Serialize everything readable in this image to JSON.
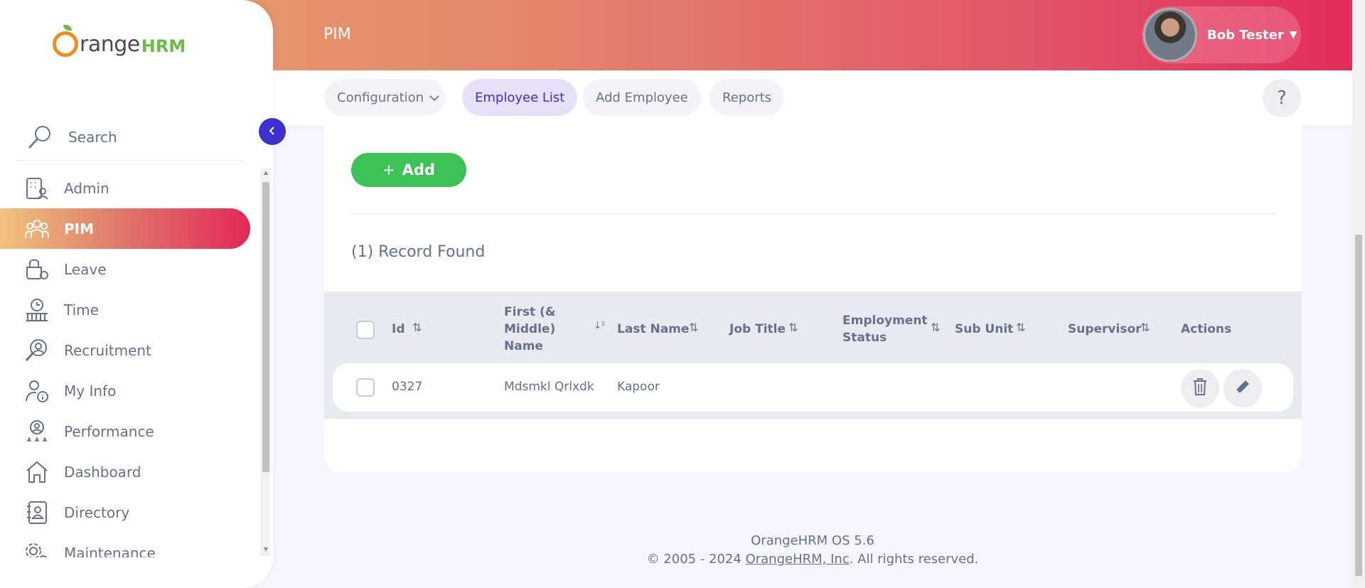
{
  "brand": {
    "name_main": "range",
    "name_suffix": "HRM"
  },
  "header": {
    "module_title": "PIM",
    "user_name": "Bob Tester"
  },
  "sidebar": {
    "search_label": "Search",
    "items": [
      {
        "label": "Admin",
        "icon": "admin-icon"
      },
      {
        "label": "PIM",
        "icon": "pim-icon",
        "active": true
      },
      {
        "label": "Leave",
        "icon": "leave-icon"
      },
      {
        "label": "Time",
        "icon": "time-icon"
      },
      {
        "label": "Recruitment",
        "icon": "recruitment-icon"
      },
      {
        "label": "My Info",
        "icon": "my-info-icon"
      },
      {
        "label": "Performance",
        "icon": "performance-icon"
      },
      {
        "label": "Dashboard",
        "icon": "dashboard-icon"
      },
      {
        "label": "Directory",
        "icon": "directory-icon"
      },
      {
        "label": "Maintenance",
        "icon": "maintenance-icon"
      }
    ]
  },
  "subnav": {
    "configuration": "Configuration",
    "employee_list": "Employee List",
    "add_employee": "Add Employee",
    "reports": "Reports",
    "help": "?"
  },
  "main": {
    "add_button": "Add",
    "records_found": "(1) Record Found",
    "columns": {
      "id": "Id",
      "first_name_l1": "First (&",
      "first_name_l2": "Middle)",
      "first_name_l3": "Name",
      "last_name": "Last Name",
      "job_title": "Job Title",
      "employment_status_l1": "Employment",
      "employment_status_l2": "Status",
      "sub_unit": "Sub Unit",
      "supervisor": "Supervisor",
      "actions": "Actions"
    },
    "rows": [
      {
        "id": "0327",
        "first_name": "Mdsmkl Qrlxdk",
        "last_name": "Kapoor",
        "job_title": "",
        "employment_status": "",
        "sub_unit": "",
        "supervisor": ""
      }
    ]
  },
  "footer": {
    "version": "OrangeHRM OS 5.6",
    "copyright_prefix": "© 2005 - 2024 ",
    "company_link": "OrangeHRM, Inc",
    "copyright_suffix": ". All rights reserved."
  },
  "colors": {
    "accent": "#3e2fd1",
    "add_green": "#3cc257",
    "active_gradient_end": "#e22858"
  }
}
